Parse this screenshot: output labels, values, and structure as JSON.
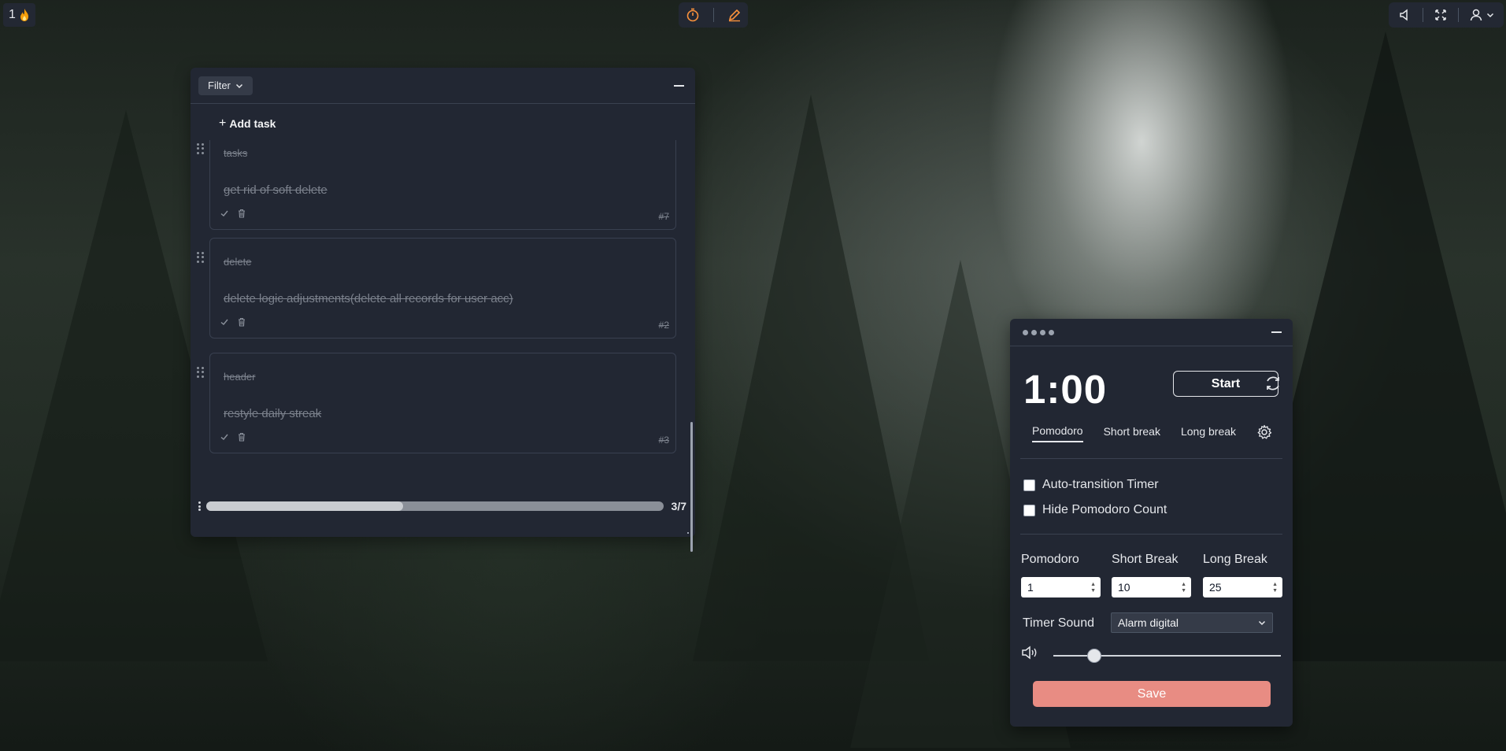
{
  "top_bar": {
    "streak_count": "1",
    "streak_icon": "flame-icon",
    "center_icons": [
      "timer-icon",
      "pencil-icon"
    ],
    "right_icons": [
      "speaker-icon",
      "fullscreen-icon",
      "user-icon",
      "chevron-down-icon"
    ]
  },
  "tasks_panel": {
    "filter_label": "Filter",
    "add_task_label": "Add task",
    "tasks": [
      {
        "tag": "tasks",
        "title": "get rid of soft delete",
        "number": "#7"
      },
      {
        "tag": "delete",
        "title": "delete logic adjustments(delete all records for user acc)",
        "number": "#2"
      },
      {
        "tag": "header",
        "title": "restyle daily streak",
        "number": "#3"
      }
    ],
    "scroll_fraction": 0.43,
    "page_count": "3/7"
  },
  "pomodoro": {
    "timer": "1:00",
    "start_label": "Start",
    "tabs": [
      "Pomodoro",
      "Short break",
      "Long break"
    ],
    "active_tab": "Pomodoro",
    "auto_transition_label": "Auto-transition Timer",
    "hide_count_label": "Hide Pomodoro Count",
    "durations": {
      "pomodoro_label": "Pomodoro",
      "pomodoro_value": "1",
      "short_break_label": "Short Break",
      "short_break_value": "10",
      "long_break_label": "Long Break",
      "long_break_value": "25"
    },
    "timer_sound_label": "Timer Sound",
    "timer_sound_value": "Alarm digital",
    "volume_fraction": 0.18,
    "save_label": "Save",
    "colors": {
      "save": "#e88c83",
      "panel": "#222733"
    }
  }
}
